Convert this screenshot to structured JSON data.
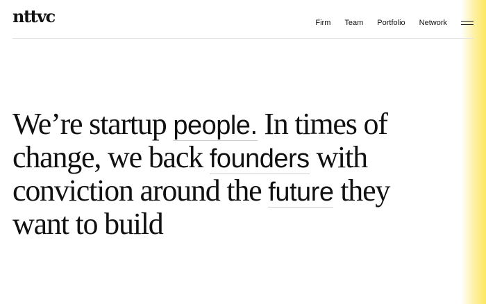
{
  "header": {
    "logo": "nttvc",
    "nav": [
      "Firm",
      "Team",
      "Portfolio",
      "Network"
    ],
    "menu_icon": "hamburger-menu-icon"
  },
  "hero": {
    "p1": "We’re startup ",
    "e1": "people.",
    "p2": " In times of change, we back ",
    "e2": "founders",
    "p3": " with conviction around the ",
    "e3": "future",
    "p4": " they want to build"
  },
  "colors": {
    "accent": "#fde85f",
    "text": "#111111",
    "divider": "#e4e4e4"
  }
}
